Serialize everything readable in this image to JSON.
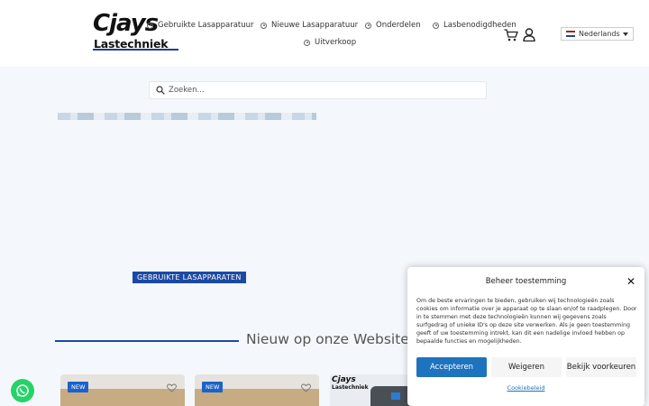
{
  "header": {
    "logo_main": "Cjays",
    "logo_sub": "Lastechniek",
    "nav": [
      {
        "label": "Gebruikte Lasapparatuur"
      },
      {
        "label": "Nieuwe Lasapparatuur"
      },
      {
        "label": "Onderdelen"
      },
      {
        "label": "Lasbenodigdheden"
      },
      {
        "label": "Uitverkoop"
      }
    ],
    "language": "Nederlands",
    "icons": [
      "cart-icon",
      "user-icon",
      "flag-nl-icon",
      "chevron-down-icon"
    ]
  },
  "search": {
    "placeholder": "Zoeken..."
  },
  "hero": {
    "category_badge": "GEBRUIKTE LASAPPARATEN"
  },
  "section": {
    "title": "Nieuw op onze Website"
  },
  "products": {
    "badge_new": "NEW",
    "card3_logo_main": "Cjays",
    "card3_logo_sub": "Lastechniek"
  },
  "cookie": {
    "title": "Beheer toestemming",
    "text": "Om de beste ervaringen te bieden, gebruiken wij technologieën zoals cookies om informatie over je apparaat op te slaan en/of te raadplegen. Door in te stemmen met deze technologieën kunnen wij gegevens zoals surfgedrag of unieke ID's op deze site verwerken. Als je geen toestemming geeft of uw toestemming intrekt, kan dit een nadelige invloed hebben op bepaalde functies en mogelijkheden.",
    "accept": "Accepteren",
    "deny": "Weigeren",
    "preferences": "Bekijk voorkeuren",
    "policy": "Cookiebeleid"
  },
  "colors": {
    "brand_blue": "#1c4aa3",
    "accept_blue": "#1e73be",
    "whatsapp": "#25d366"
  }
}
